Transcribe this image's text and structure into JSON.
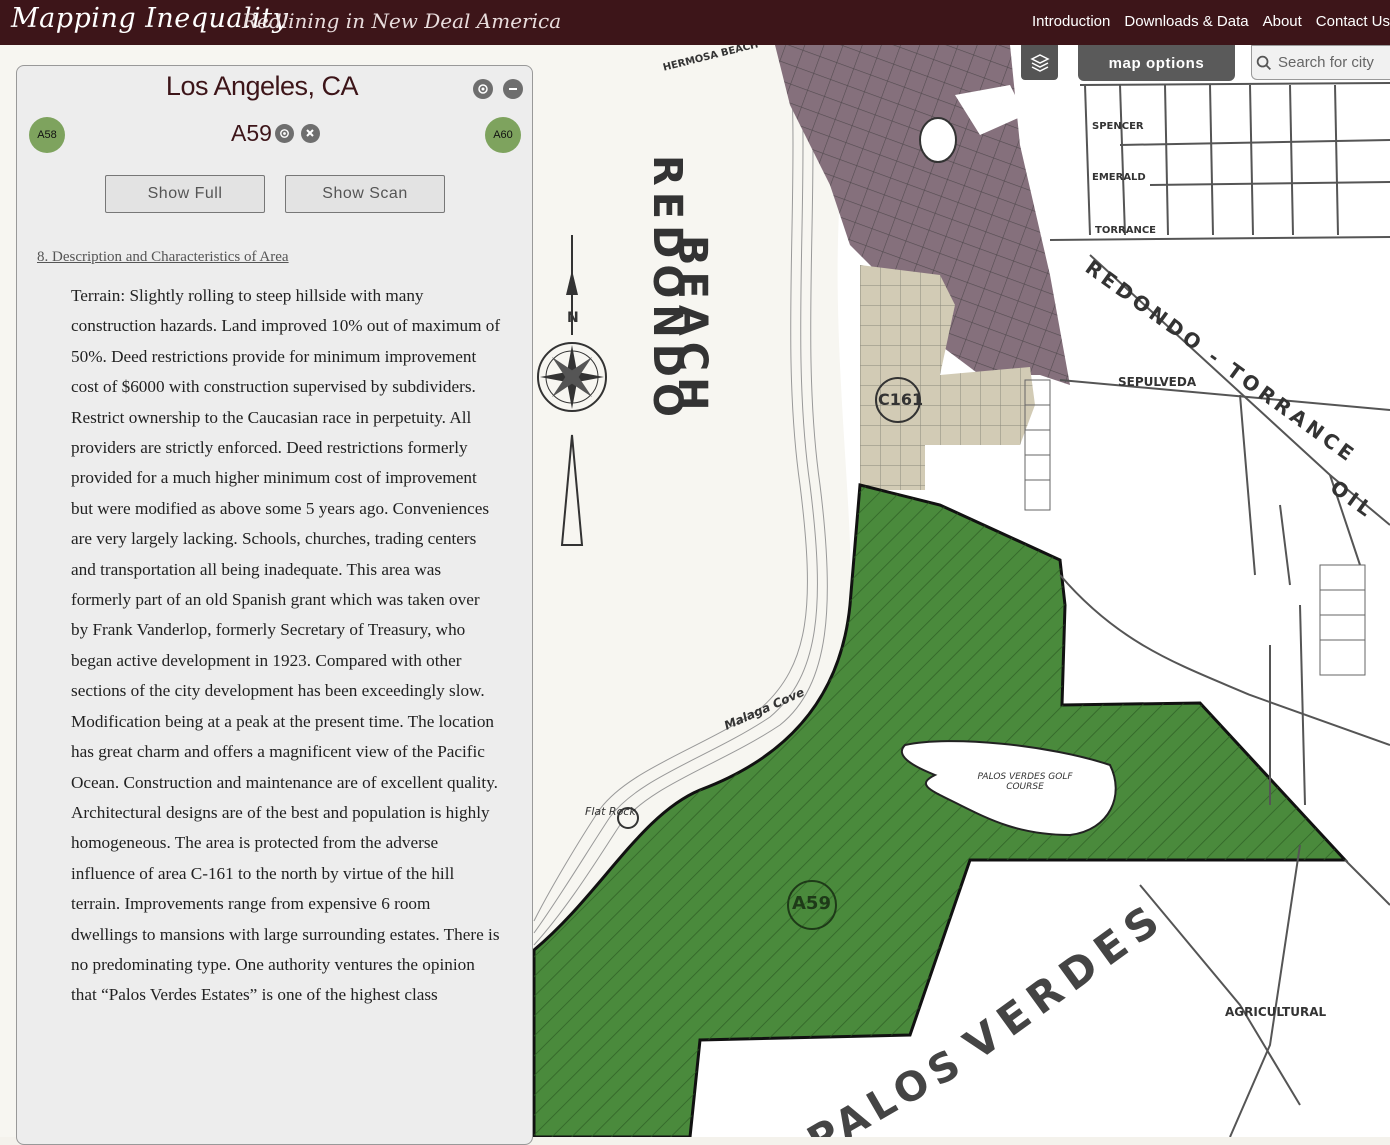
{
  "header": {
    "title": "Mapping Inequality",
    "subtitle": "Redlining in New Deal America",
    "nav": [
      "Introduction",
      "Downloads & Data",
      "About",
      "Contact Us"
    ]
  },
  "map_controls": {
    "layers_icon": "layers-icon",
    "options_label": "map options",
    "search_placeholder": "Search for city"
  },
  "panel": {
    "city": "Los Angeles, CA",
    "grade_id": "A59",
    "prev_area": "A58",
    "next_area": "A60",
    "show_full_label": "Show Full",
    "show_scan_label": "Show Scan",
    "section_title": "8. Description and Characteristics of Area",
    "description": "Terrain: Slightly rolling to steep hillside with many construction hazards. Land improved 10% out of maximum of 50%. Deed restrictions provide for minimum improvement cost of $6000 with construction supervised by subdividers. Restrict ownership to the Caucasian race in perpetuity. All providers are strictly enforced. Deed restrictions formerly provided for a much higher minimum cost of improvement but were modified as above some 5 years ago. Conveniences are very largely lacking. Schools, churches, trading centers and transportation all being inadequate. This area was formerly part of an old Spanish grant which was taken over by Frank Vanderlop, formerly Secretary of Treasury, who began active development in 1923. Compared with other sections of the city development has been exceedingly slow. Modification being at a peak at the present time. The location has great charm and offers a magnificent view of the Pacific Ocean. Construction and maintenance are of excellent quality. Architectural designs are of the best and population is highly homogeneous. The area is protected from the adverse influence of area C-161 to the north by virtue of the hill terrain. Improvements range from expensive 6 room dwellings to mansions with large surrounding estates. There is no predominating type. One authority ventures the opinion that “Palos Verdes Estates” is one of the highest class"
  },
  "map_labels": {
    "redondo": "REDONDO",
    "beach": "BEACH",
    "redondo_torrance": "REDONDO - TORRANCE",
    "sepulveda": "SEPULVEDA",
    "palos": "PALOS",
    "verdes": "VERDES",
    "agricultural": "AGRICULTURAL",
    "golf_course": "PALOS  VERDES GOLF  COURSE",
    "malaga_cove": "Malaga Cove",
    "flat_rock": "Flat Rock",
    "a59_label": "A59",
    "c161_label": "C161",
    "hermosa": "HERMOSA BEACH",
    "torrance": "TORRANCE",
    "emerald": "EMERALD",
    "spencer": "SPENCER",
    "oil": "OIL",
    "compass_n": "N"
  },
  "colors": {
    "header_bg": "#3d1519",
    "grade_a": "#4a8a3c",
    "grade_c_light": "#d2cbb5",
    "grade_d": "#85707c",
    "neighbor_btn": "#7ea35e"
  }
}
